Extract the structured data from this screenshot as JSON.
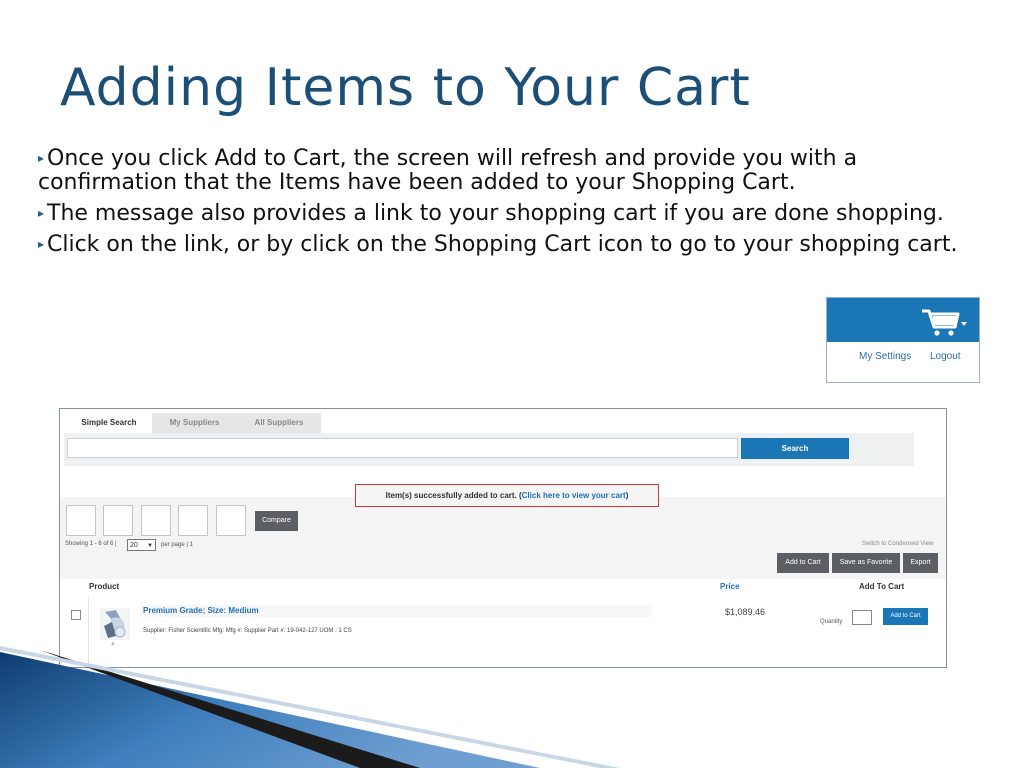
{
  "slide": {
    "title": "Adding Items to Your Cart",
    "bullets": [
      "Once you click Add to Cart, the screen will refresh and provide you with a confirmation that the Items have been added to your Shopping Cart.",
      "The message also provides a link to your shopping cart if you are done shopping.",
      "Click on the link, or by click on the Shopping Cart icon to go to your shopping cart."
    ],
    "bullet_marker": "▸"
  },
  "header_widget": {
    "icon": "shopping-cart-icon",
    "my_settings": "My Settings",
    "logout": "Logout"
  },
  "screenshot": {
    "tabs": [
      "Simple Search",
      "My Suppliers",
      "All Suppliers"
    ],
    "active_tab": "Simple Search",
    "search": {
      "value": "",
      "button": "Search"
    },
    "message": {
      "text": "Item(s) successfully added to cart. (",
      "link": "Click here to view your cart",
      "close": ")"
    },
    "compare_button": "Compare",
    "showing": "Showing 1 - 6 of 6 |",
    "per_page_value": "20",
    "per_page_label": "per page | 1",
    "switch_view": "Switch to Condensed View",
    "actions": [
      "Add to Cart",
      "Save as Favorite",
      "Export"
    ],
    "columns": {
      "product": "Product",
      "price": "Price",
      "add": "Add To Cart"
    },
    "rows": [
      {
        "name": "Premium Grade; Size: Medium",
        "supplier_line": "Supplier: Fisher Scientific    Mfg:    Mfg #:    Supplier Part #: 19-042-127    UOM : 1 CS",
        "price": "$1,089.46",
        "quantity_label": "Quantity",
        "button": "Add to Cart"
      }
    ]
  },
  "colors": {
    "title": "#1c4f77",
    "primary_blue": "#1a76b5",
    "alert_border": "#c9393a",
    "gray_button": "#5b5f63"
  }
}
